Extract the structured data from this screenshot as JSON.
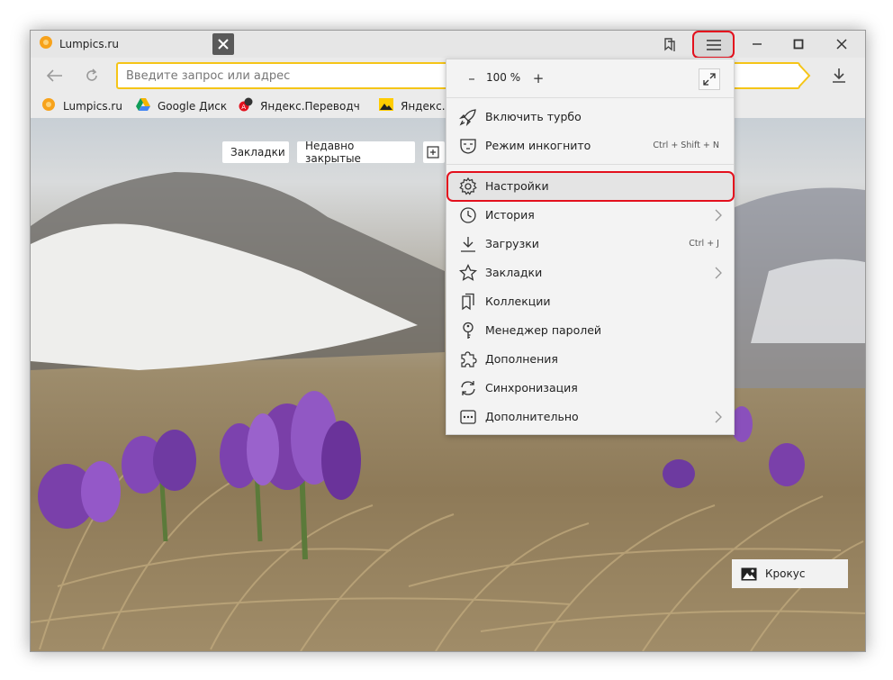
{
  "tab": {
    "title": "Lumpics.ru"
  },
  "address": {
    "placeholder": "Введите запрос или адрес"
  },
  "bookmarks": [
    {
      "label": "Lumpics.ru",
      "icon": "orange-circle-icon"
    },
    {
      "label": "Google Диск",
      "icon": "google-drive-icon"
    },
    {
      "label": "Яндекс.Переводч",
      "icon": "yandex-translate-icon"
    },
    {
      "label": "Яндекс.",
      "icon": "yandex-images-icon"
    }
  ],
  "quick_buttons": [
    "Закладки",
    "Недавно закрытые"
  ],
  "menu": {
    "zoom": {
      "minus": "–",
      "value": "100 %",
      "plus": "+"
    },
    "items": [
      {
        "label": "Включить турбо",
        "icon": "rocket-icon",
        "shortcut": ""
      },
      {
        "label": "Режим инкогнито",
        "icon": "incognito-mask-icon",
        "shortcut": "Ctrl + Shift + N"
      },
      {
        "label": "Настройки",
        "icon": "gear-icon",
        "shortcut": ""
      },
      {
        "label": "История",
        "icon": "clock-icon",
        "shortcut": ""
      },
      {
        "label": "Загрузки",
        "icon": "download-icon",
        "shortcut": "Ctrl + J"
      },
      {
        "label": "Закладки",
        "icon": "star-icon",
        "shortcut": ""
      },
      {
        "label": "Коллекции",
        "icon": "collections-icon",
        "shortcut": ""
      },
      {
        "label": "Менеджер паролей",
        "icon": "key-icon",
        "shortcut": ""
      },
      {
        "label": "Дополнения",
        "icon": "puzzle-icon",
        "shortcut": ""
      },
      {
        "label": "Синхронизация",
        "icon": "sync-icon",
        "shortcut": ""
      },
      {
        "label": "Дополнительно",
        "icon": "more-icon",
        "shortcut": ""
      }
    ]
  },
  "photo": {
    "caption": "Крокус"
  },
  "colors": {
    "highlight": "#e3101d",
    "omnibox_border": "#f5c518"
  }
}
